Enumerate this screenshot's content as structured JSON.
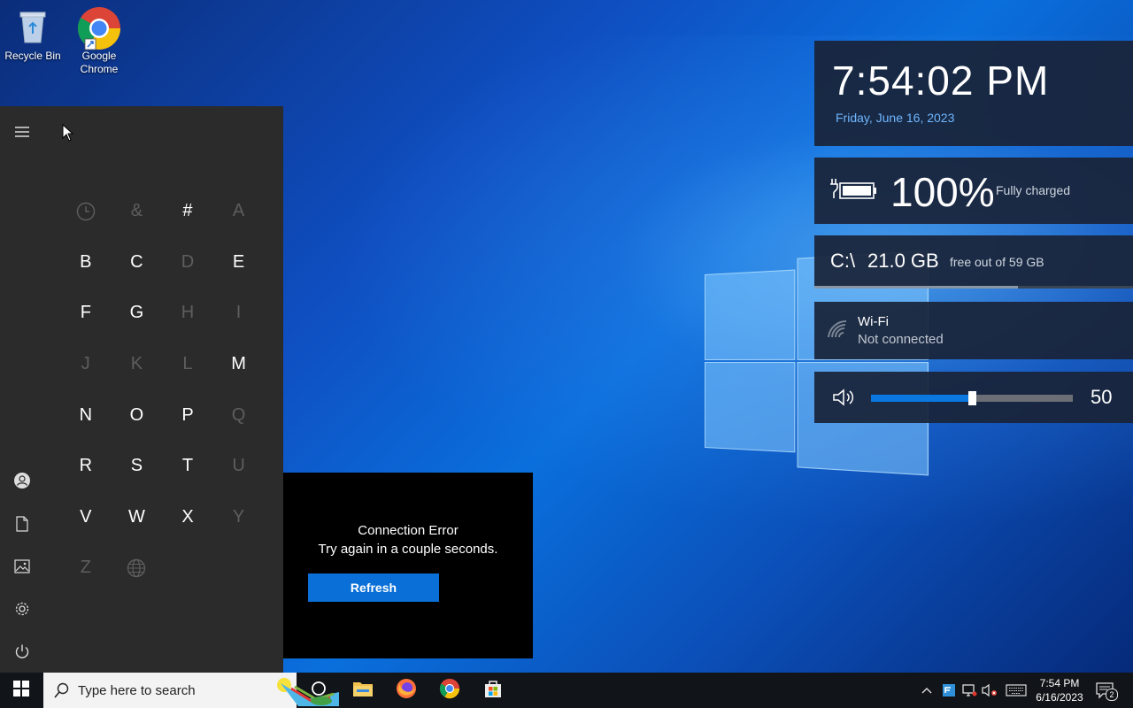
{
  "desktop": {
    "icons": [
      {
        "label": "Recycle Bin"
      },
      {
        "label": "Google Chrome"
      }
    ]
  },
  "start_menu": {
    "letters": [
      {
        "char": "",
        "icon": "clock-icon",
        "enabled": false
      },
      {
        "char": "&",
        "enabled": false
      },
      {
        "char": "#",
        "enabled": true
      },
      {
        "char": "A",
        "enabled": false
      },
      {
        "char": "B",
        "enabled": true
      },
      {
        "char": "C",
        "enabled": true
      },
      {
        "char": "D",
        "enabled": false
      },
      {
        "char": "E",
        "enabled": true
      },
      {
        "char": "F",
        "enabled": true
      },
      {
        "char": "G",
        "enabled": true
      },
      {
        "char": "H",
        "enabled": false
      },
      {
        "char": "I",
        "enabled": false
      },
      {
        "char": "J",
        "enabled": false
      },
      {
        "char": "K",
        "enabled": false
      },
      {
        "char": "L",
        "enabled": false
      },
      {
        "char": "M",
        "enabled": true
      },
      {
        "char": "N",
        "enabled": true
      },
      {
        "char": "O",
        "enabled": true
      },
      {
        "char": "P",
        "enabled": true
      },
      {
        "char": "Q",
        "enabled": false
      },
      {
        "char": "R",
        "enabled": true
      },
      {
        "char": "S",
        "enabled": true
      },
      {
        "char": "T",
        "enabled": true
      },
      {
        "char": "U",
        "enabled": false
      },
      {
        "char": "V",
        "enabled": true
      },
      {
        "char": "W",
        "enabled": true
      },
      {
        "char": "X",
        "enabled": true
      },
      {
        "char": "Y",
        "enabled": false
      },
      {
        "char": "Z",
        "enabled": false
      },
      {
        "char": "",
        "icon": "globe-icon",
        "enabled": false
      }
    ]
  },
  "connection_panel": {
    "title": "Connection Error",
    "message": "Try again in a couple seconds.",
    "refresh_label": "Refresh"
  },
  "widgets": {
    "clock": {
      "time": "7:54:02 PM",
      "date": "Friday, June 16, 2023"
    },
    "battery": {
      "percent": "100%",
      "status": "Fully charged"
    },
    "disk": {
      "path": "C:\\",
      "free": "21.0 GB",
      "of_total": "free out of 59 GB",
      "used_fraction": 0.64
    },
    "wifi": {
      "name": "Wi-Fi",
      "status": "Not connected"
    },
    "volume": {
      "value": "50",
      "level": 0.5
    }
  },
  "taskbar": {
    "search_placeholder": "Type here to search",
    "time": "7:54 PM",
    "date": "6/16/2023",
    "notification_count": "2"
  },
  "colors": {
    "accent": "#0a78e0",
    "date_blue": "#6fb6ff"
  }
}
